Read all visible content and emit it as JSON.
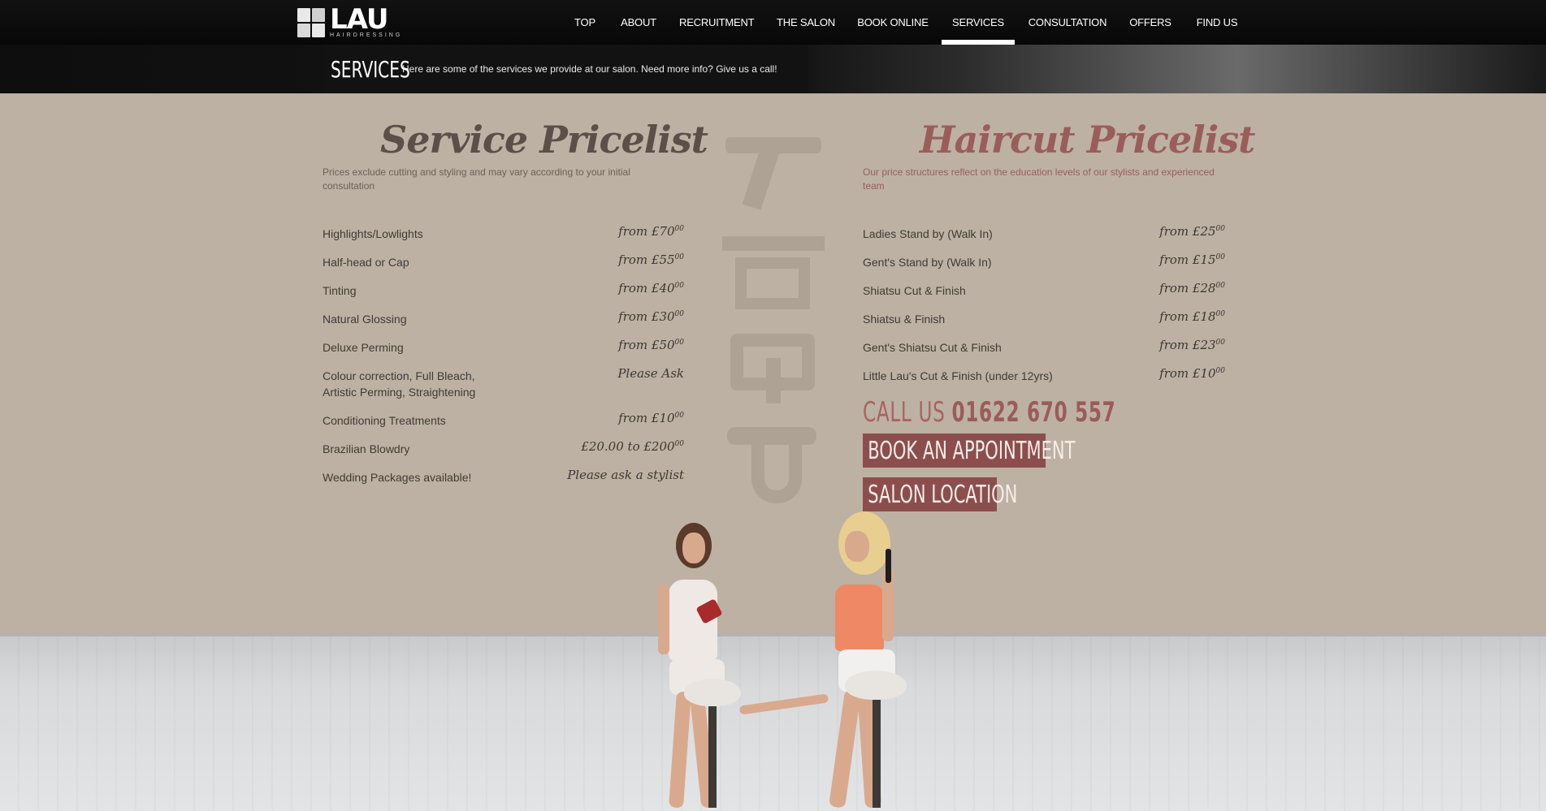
{
  "brand": {
    "name": "LAU",
    "tagline": "HAIRDRESSING"
  },
  "nav": {
    "items": [
      {
        "label": "TOP"
      },
      {
        "label": "ABOUT"
      },
      {
        "label": "RECRUITMENT"
      },
      {
        "label": "THE SALON"
      },
      {
        "label": "BOOK ONLINE"
      },
      {
        "label": "SERVICES",
        "active": true
      },
      {
        "label": "CONSULTATION"
      },
      {
        "label": "OFFERS"
      },
      {
        "label": "FIND US"
      }
    ]
  },
  "page_header": {
    "title": "SERVICES",
    "subtitle": "Here are some of the services we provide at our salon. Need more info? Give us a call!"
  },
  "service_pricelist": {
    "title": "Service Pricelist",
    "note": "Prices exclude cutting and styling and may vary according to your initial consultation",
    "items": [
      {
        "name": "Highlights/Lowlights",
        "price": "from £70",
        "pence": "00"
      },
      {
        "name": "Half-head or Cap",
        "price": "from £55",
        "pence": "00"
      },
      {
        "name": "Tinting",
        "price": "from £40",
        "pence": "00"
      },
      {
        "name": "Natural Glossing",
        "price": "from £30",
        "pence": "00"
      },
      {
        "name": "Deluxe Perming",
        "price": "from £50",
        "pence": "00"
      },
      {
        "name": "Colour correction, Full Bleach, Artistic Perming, Straightening",
        "price": "Please Ask",
        "pence": ""
      },
      {
        "name": "Conditioning Treatments",
        "price": "from £10",
        "pence": "00"
      },
      {
        "name": "Brazilian Blowdry",
        "price": "£20.00 to £200",
        "pence": "00"
      },
      {
        "name": "Wedding Packages available!",
        "price": "Please ask a stylist",
        "pence": ""
      }
    ]
  },
  "haircut_pricelist": {
    "title": "Haircut Pricelist",
    "note": "Our price structures reflect on the education levels of our stylists and experienced team",
    "items": [
      {
        "name": "Ladies Stand by (Walk In)",
        "price": "from £25",
        "pence": "00"
      },
      {
        "name": "Gent's Stand by (Walk In)",
        "price": "from £15",
        "pence": "00"
      },
      {
        "name": "Shiatsu Cut & Finish",
        "price": "from £28",
        "pence": "00"
      },
      {
        "name": "Shiatsu & Finish",
        "price": "from £18",
        "pence": "00"
      },
      {
        "name": "Gent's Shiatsu Cut & Finish",
        "price": "from £23",
        "pence": "00"
      },
      {
        "name": "Little Lau's Cut & Finish (under 12yrs)",
        "price": "from £10",
        "pence": "00"
      }
    ]
  },
  "contact": {
    "call_label": "CALL US",
    "phone": "01622 670 557",
    "book_label": "BOOK AN APPOINTMENT",
    "location_label": "SALON LOCATION"
  },
  "colors": {
    "background": "#bdb1a4",
    "service_title": "#5c4f4a",
    "haircut_title": "#9b5d5a",
    "cta": "#8c4e4c",
    "nav_bg": "#0b0b0b"
  }
}
